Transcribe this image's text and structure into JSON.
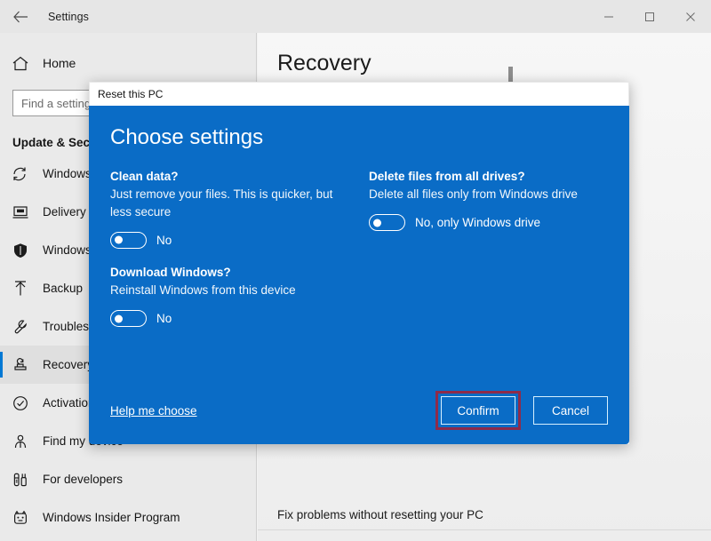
{
  "window": {
    "title": "Settings",
    "back_icon": "back-arrow-icon",
    "minimize_label": "Minimize",
    "maximize_label": "Maximize",
    "close_label": "Close"
  },
  "sidebar": {
    "home_label": "Home",
    "home_icon": "home-icon",
    "search_placeholder": "Find a setting",
    "section_title": "Update & Security",
    "items": [
      {
        "label": "Windows Update",
        "icon": "sync-icon",
        "selected": false
      },
      {
        "label": "Delivery Optimization",
        "icon": "delivery-icon",
        "selected": false
      },
      {
        "label": "Windows Security",
        "icon": "shield-icon",
        "selected": false
      },
      {
        "label": "Backup",
        "icon": "upload-arrow-icon",
        "selected": false
      },
      {
        "label": "Troubleshoot",
        "icon": "wrench-icon",
        "selected": false
      },
      {
        "label": "Recovery",
        "icon": "recovery-icon",
        "selected": true
      },
      {
        "label": "Activation",
        "icon": "check-circle-icon",
        "selected": false
      },
      {
        "label": "Find my device",
        "icon": "person-pin-icon",
        "selected": false
      },
      {
        "label": "For developers",
        "icon": "tools-icon",
        "selected": false
      },
      {
        "label": "Windows Insider Program",
        "icon": "insider-icon",
        "selected": false
      }
    ]
  },
  "main": {
    "page_title": "Recovery",
    "note": "Fix problems without resetting your PC"
  },
  "dialog": {
    "title": "Reset this PC",
    "heading": "Choose settings",
    "groups_left": [
      {
        "title": "Clean data?",
        "description": "Just remove your files. This is quicker, but less secure",
        "toggle_value": "No",
        "toggle_on": false
      },
      {
        "title": "Download Windows?",
        "description": "Reinstall Windows from this device",
        "toggle_value": "No",
        "toggle_on": false
      }
    ],
    "groups_right": [
      {
        "title": "Delete files from all drives?",
        "description": "Delete all files only from Windows drive",
        "toggle_value": "No, only Windows drive",
        "toggle_on": false
      }
    ],
    "help_link": "Help me choose",
    "confirm_label": "Confirm",
    "cancel_label": "Cancel",
    "accent_blue": "#0a6cc6",
    "highlight_color": "#8e2b4a"
  }
}
